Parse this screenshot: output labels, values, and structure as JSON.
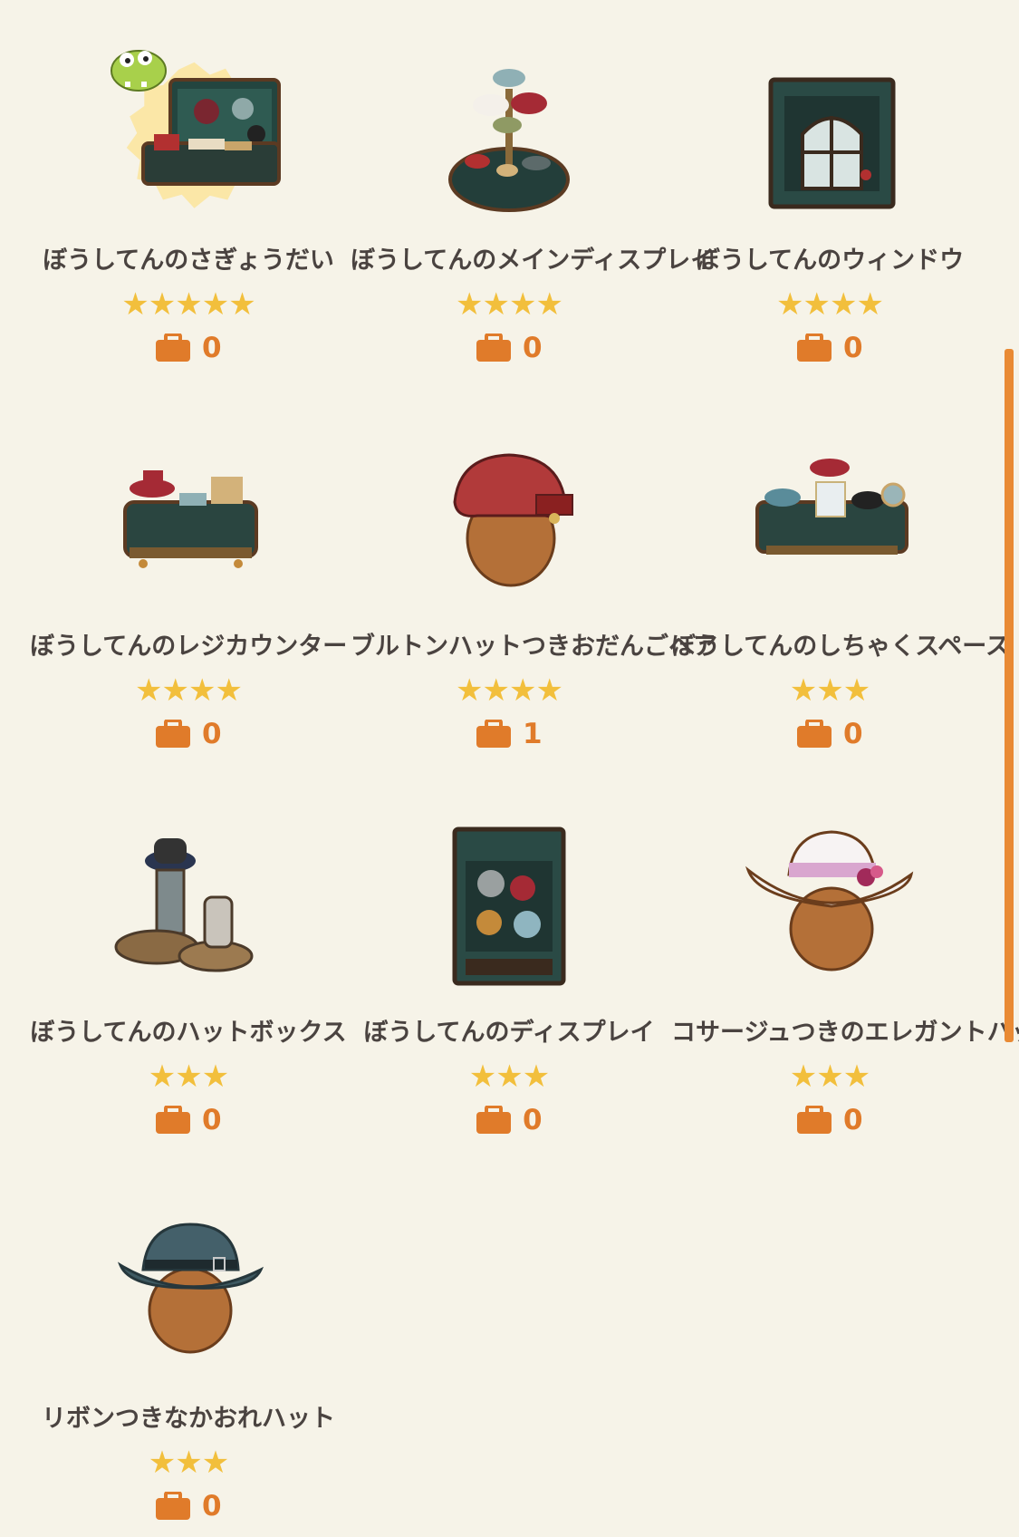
{
  "colors": {
    "background": "#f6f3e8",
    "star": "#f2bf3c",
    "accent": "#e07b2a",
    "text": "#4a4340",
    "scrollbar": "#e98a34"
  },
  "items": [
    {
      "name": "ぼうしてんのさぎょうだい",
      "stars": "★★★★★",
      "count": "0",
      "icon": "hat-shop-workbench-icon",
      "badge": "frog-character-badge"
    },
    {
      "name": "ぼうしてんのメインディスプレイ",
      "stars": "★★★★",
      "count": "0",
      "icon": "hat-main-display-icon"
    },
    {
      "name": "ぼうしてんのウィンドウ",
      "stars": "★★★★",
      "count": "0",
      "icon": "hat-shop-window-icon"
    },
    {
      "name": "ぼうしてんのレジカウンター",
      "stars": "★★★★",
      "count": "0",
      "icon": "register-counter-icon"
    },
    {
      "name": "ブルトンハットつきおだんごヘア",
      "stars": "★★★★",
      "count": "1",
      "icon": "breton-hat-bun-hair-icon"
    },
    {
      "name": "ぼうしてんのしちゃくスペース",
      "stars": "★★★",
      "count": "0",
      "icon": "fitting-space-icon"
    },
    {
      "name": "ぼうしてんのハットボックス",
      "stars": "★★★",
      "count": "0",
      "icon": "hat-box-icon"
    },
    {
      "name": "ぼうしてんのディスプレイ",
      "stars": "★★★",
      "count": "0",
      "icon": "hat-display-case-icon"
    },
    {
      "name": "コサージュつきのエレガントハット",
      "stars": "★★★",
      "count": "0",
      "icon": "corsage-elegant-hat-icon"
    },
    {
      "name": "リボンつきなかおれハット",
      "stars": "★★★",
      "count": "0",
      "icon": "ribbon-fedora-hat-icon"
    }
  ]
}
